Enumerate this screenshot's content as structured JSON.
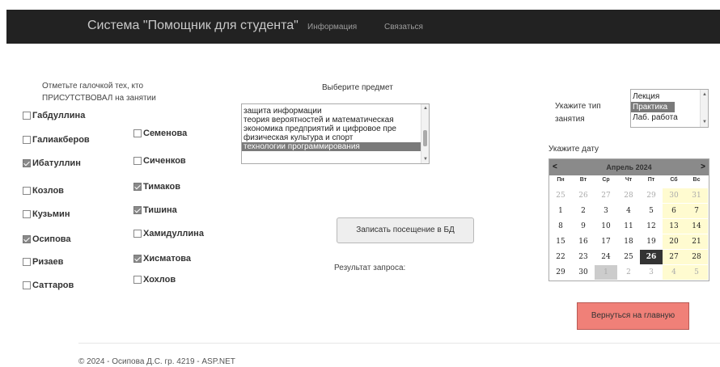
{
  "navbar": {
    "brand": "Система \"Помощник для студента\"",
    "links": [
      "Информация",
      "Связаться"
    ]
  },
  "attendance": {
    "instruction_line1": "Отметьте галочкой тех, кто",
    "instruction_line2": "ПРИСУТСТВОВАЛ на занятии",
    "students": [
      {
        "name": "Габдуллина",
        "checked": false
      },
      {
        "name": "Галиакберов",
        "checked": false
      },
      {
        "name": "Ибатуллин",
        "checked": true
      },
      {
        "name": "Козлов",
        "checked": false
      },
      {
        "name": "Кузьмин",
        "checked": false
      },
      {
        "name": "Осипова",
        "checked": true
      },
      {
        "name": "Ризаев",
        "checked": false
      },
      {
        "name": "Саттаров",
        "checked": false
      },
      {
        "name": "Семенова",
        "checked": false
      },
      {
        "name": "Сиченков",
        "checked": false
      },
      {
        "name": "Тимаков",
        "checked": true
      },
      {
        "name": "Тишина",
        "checked": true
      },
      {
        "name": "Хамидуллина",
        "checked": false
      },
      {
        "name": "Хисматова",
        "checked": true
      },
      {
        "name": "Хохлов",
        "checked": false
      }
    ]
  },
  "subject": {
    "label": "Выберите предмет",
    "options": [
      "защита информации",
      "теория вероятностей и математическая",
      "экономика предприятий и цифровое пре",
      "физическая культура и спорт",
      "технологии программирования"
    ],
    "selected_index": 4
  },
  "record_button": "Записать посещение в БД",
  "result_label": "Результат запроса:",
  "lesson_type": {
    "label_line1": "Укажите тип",
    "label_line2": "занятия",
    "options": [
      "Лекция",
      "Практика",
      "Лаб. работа"
    ],
    "selected_index": 1
  },
  "date": {
    "label": "Укажите дату",
    "calendar": {
      "prev": "<",
      "next": ">",
      "title": "Апрель 2024",
      "weekdays": [
        "Пн",
        "Вт",
        "Ср",
        "Чт",
        "Пт",
        "Сб",
        "Вс"
      ],
      "weeks": [
        [
          "25",
          "26",
          "27",
          "28",
          "29",
          "30",
          "31"
        ],
        [
          "1",
          "2",
          "3",
          "4",
          "5",
          "6",
          "7"
        ],
        [
          "8",
          "9",
          "10",
          "11",
          "12",
          "13",
          "14"
        ],
        [
          "15",
          "16",
          "17",
          "18",
          "19",
          "20",
          "21"
        ],
        [
          "22",
          "23",
          "24",
          "25",
          "26",
          "27",
          "28"
        ],
        [
          "29",
          "30",
          "1",
          "2",
          "3",
          "4",
          "5"
        ]
      ],
      "selected_day": "26",
      "today_day": "1"
    }
  },
  "home_button": "Вернуться на главную",
  "footer": "© 2024 - Осипова Д.С. гр. 4219 - ASP.NET"
}
